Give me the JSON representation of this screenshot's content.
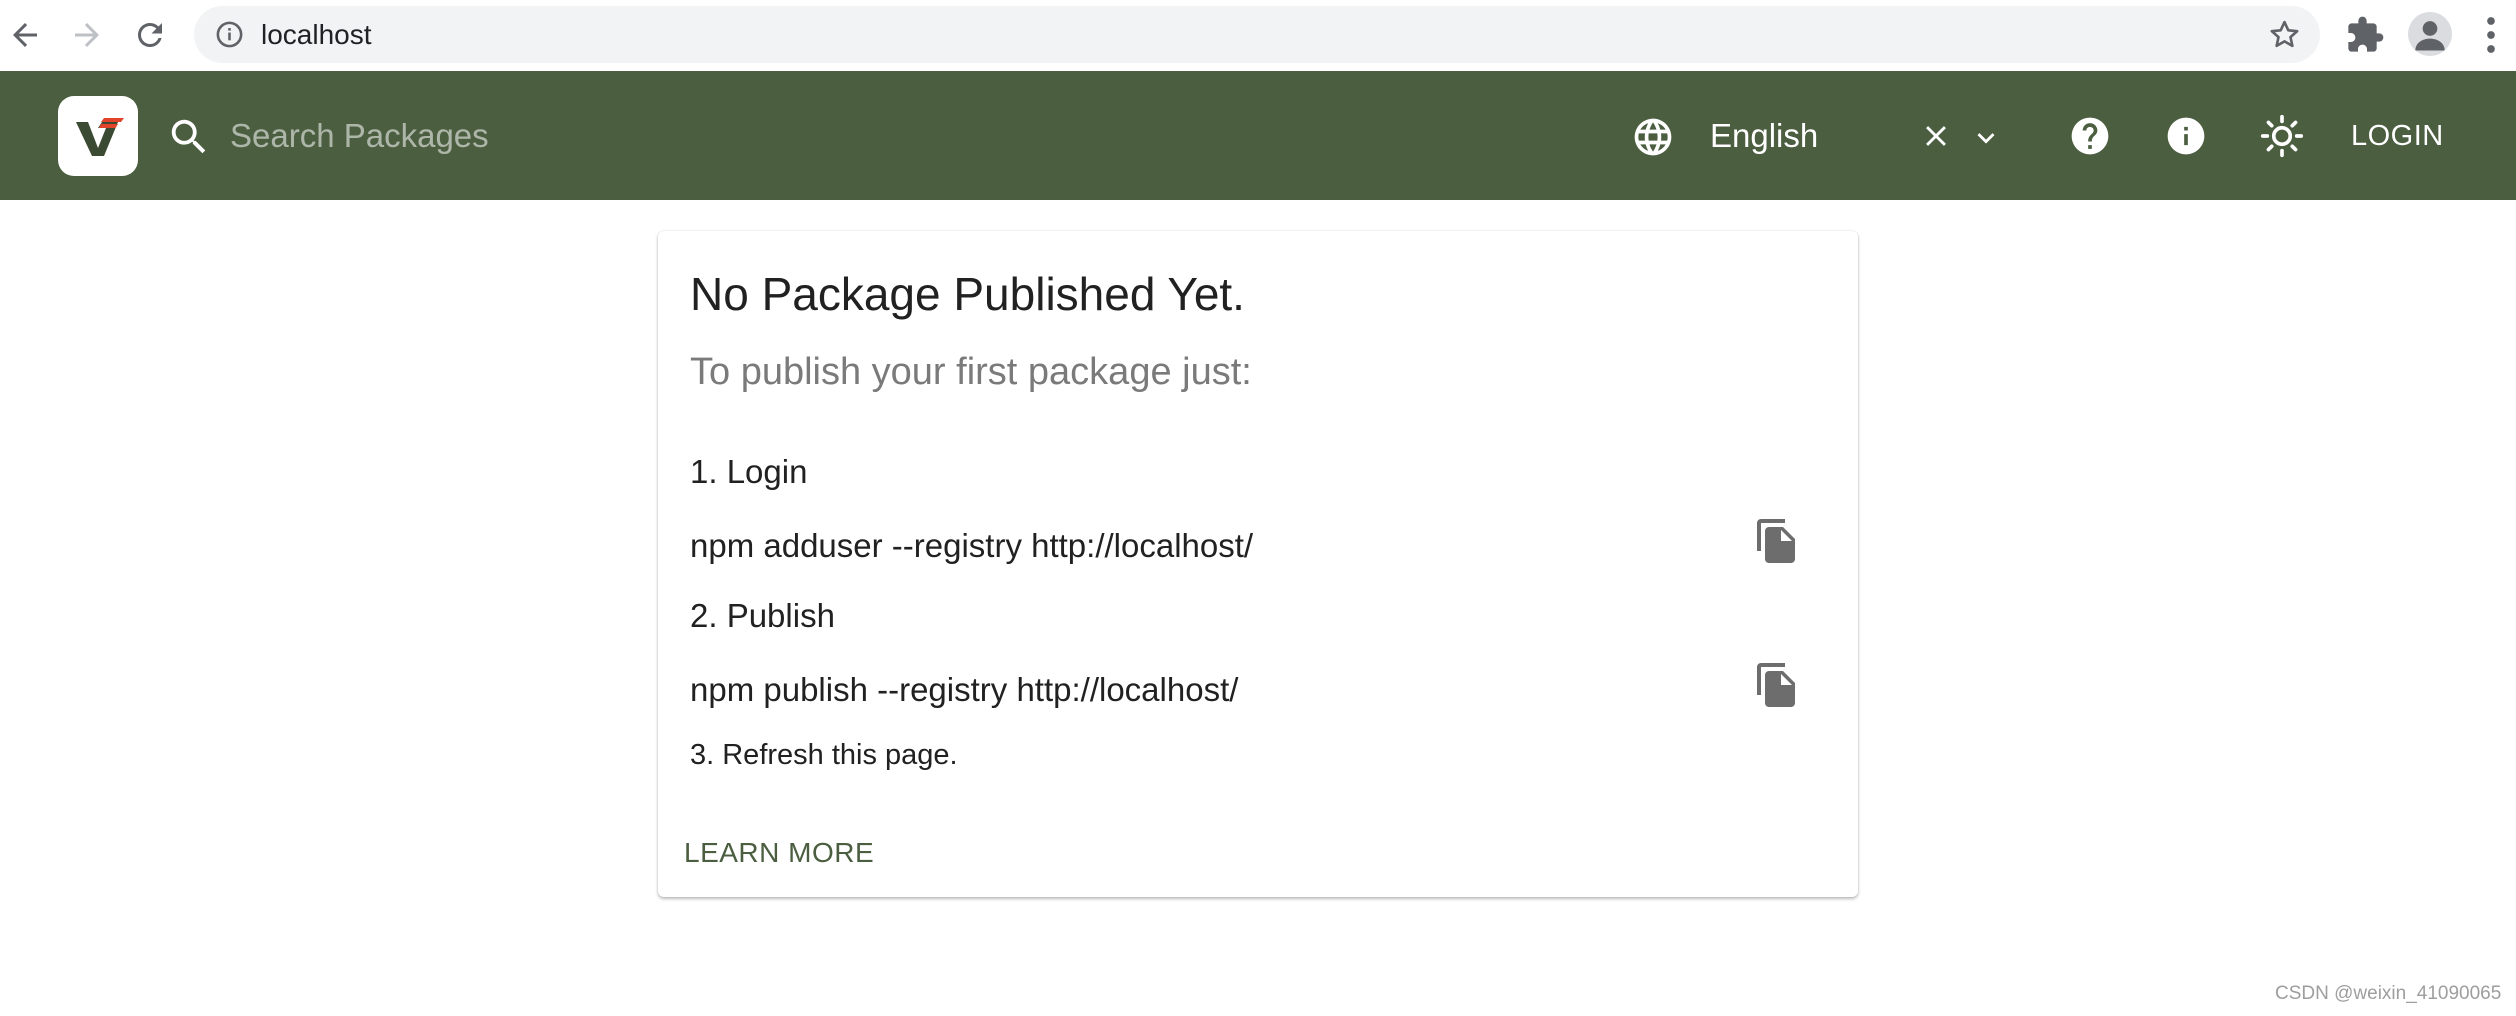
{
  "browser": {
    "url": "localhost"
  },
  "header": {
    "search_placeholder": "Search Packages",
    "language": "English",
    "login_label": "LOGIN",
    "colors": {
      "background": "#4b5e40",
      "text": "#ffffff"
    }
  },
  "card": {
    "title": "No Package Published Yet.",
    "subtitle": "To publish your first package just:",
    "steps": [
      {
        "title": "1. Login",
        "command": "npm adduser --registry http://localhost/"
      },
      {
        "title": "2. Publish",
        "command": "npm publish --registry http://localhost/"
      },
      {
        "title": "3. Refresh this page."
      }
    ],
    "learn_more": "LEARN MORE"
  },
  "watermark": "CSDN @weixin_41090065",
  "icons": [
    "back-icon",
    "forward-icon",
    "reload-icon",
    "info-icon",
    "star-icon",
    "extensions-icon",
    "profile-icon",
    "menu-icon",
    "verdaccio-logo",
    "search-icon",
    "globe-icon",
    "clear-icon",
    "chevron-down-icon",
    "help-icon",
    "info-icon",
    "theme-toggle-icon",
    "copy-icon"
  ]
}
